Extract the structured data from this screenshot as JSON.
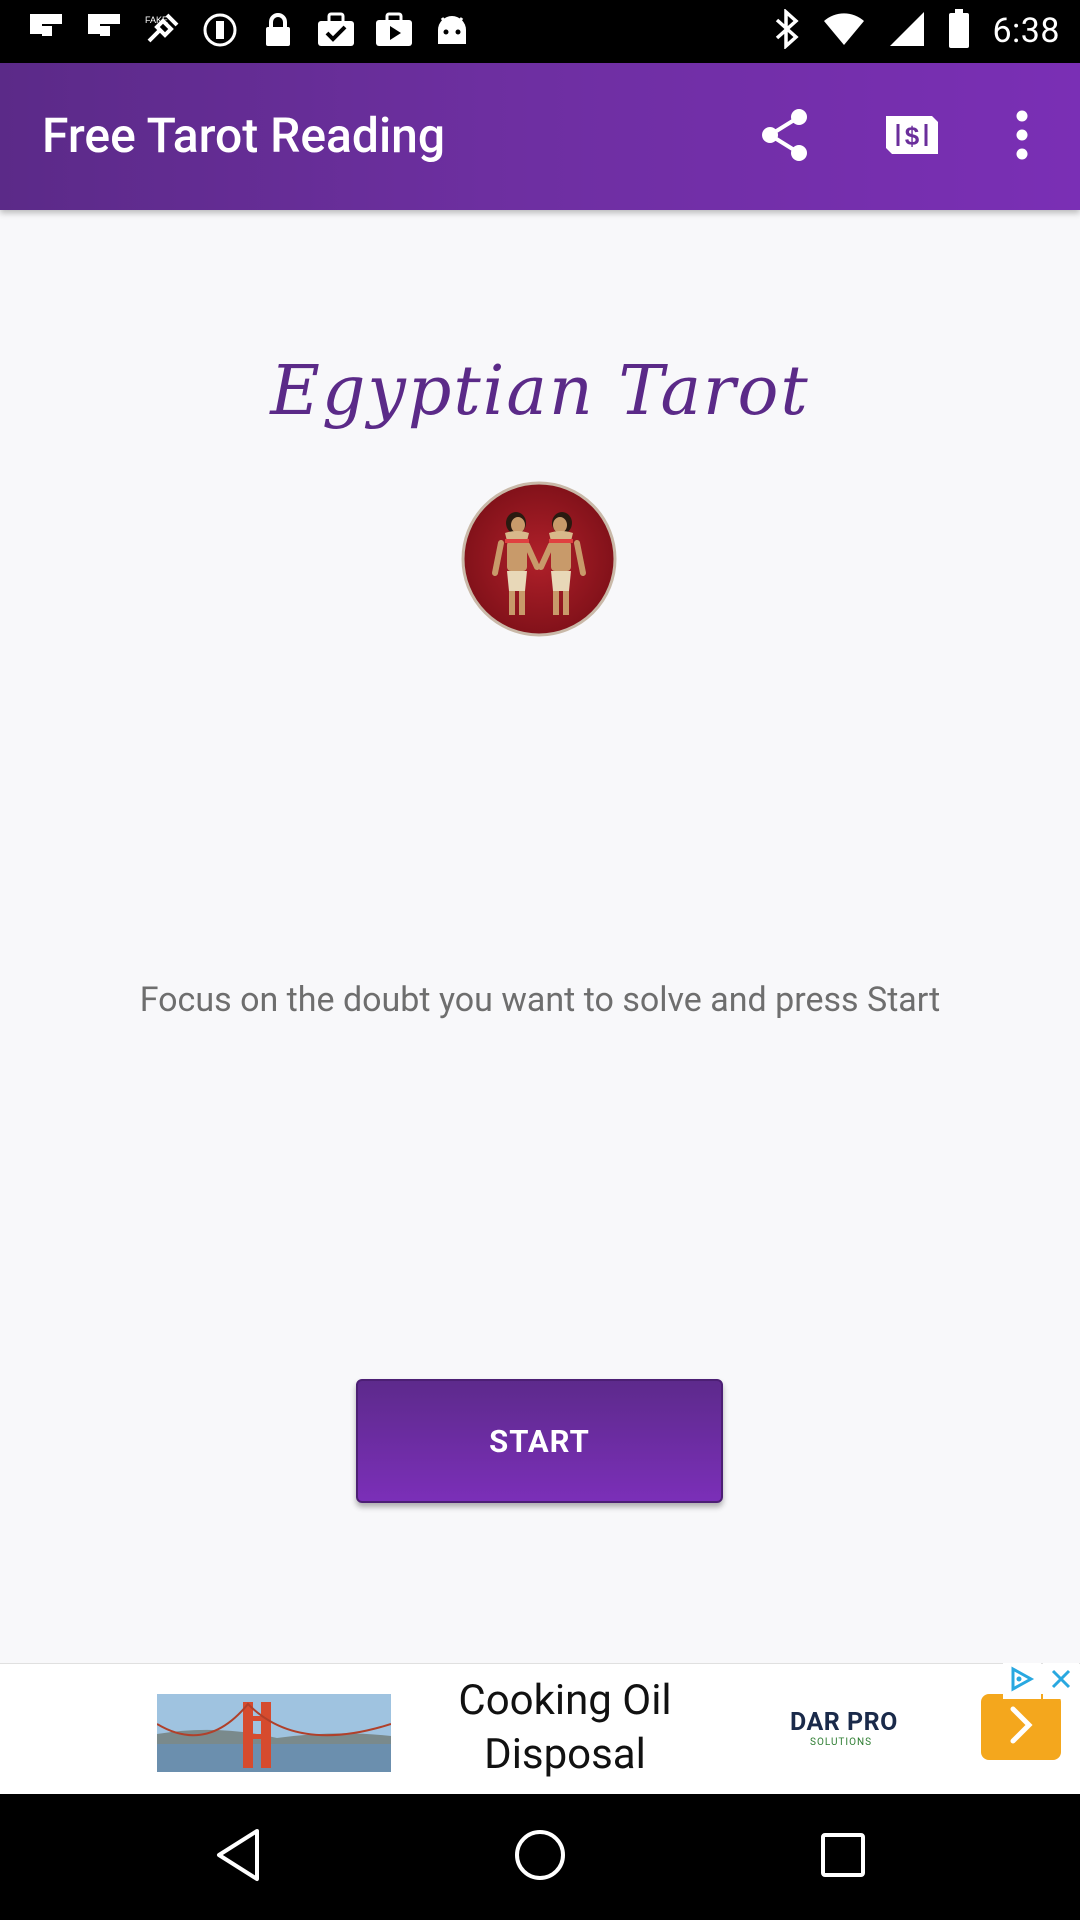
{
  "status_bar": {
    "time": "6:38",
    "left_icons": [
      "flipboard-icon",
      "flipboard-icon",
      "fake-gps-icon",
      "record-icon",
      "lock-icon",
      "briefcase-check-icon",
      "play-store-icon",
      "android-icon"
    ],
    "right_icons": [
      "bluetooth-icon",
      "wifi-icon",
      "signal-icon",
      "battery-icon"
    ]
  },
  "app_bar": {
    "title": "Free Tarot Reading",
    "actions": [
      "share-icon",
      "money-icon",
      "more-vert-icon"
    ]
  },
  "main": {
    "heading": "Egyptian Tarot",
    "instruction": "Focus on the doubt you want to solve and press Start",
    "start_label": "START"
  },
  "ad": {
    "headline": "Cooking Oil Disposal",
    "brand": "DAR PRO",
    "brand_sub": "SOLUTIONS"
  },
  "nav": [
    "back-icon",
    "home-icon",
    "recents-icon"
  ],
  "colors": {
    "primary": "#6d2fa0",
    "primary_dark": "#5b2a88",
    "accent_orange": "#f4a71d",
    "background": "#f8f8fa"
  }
}
